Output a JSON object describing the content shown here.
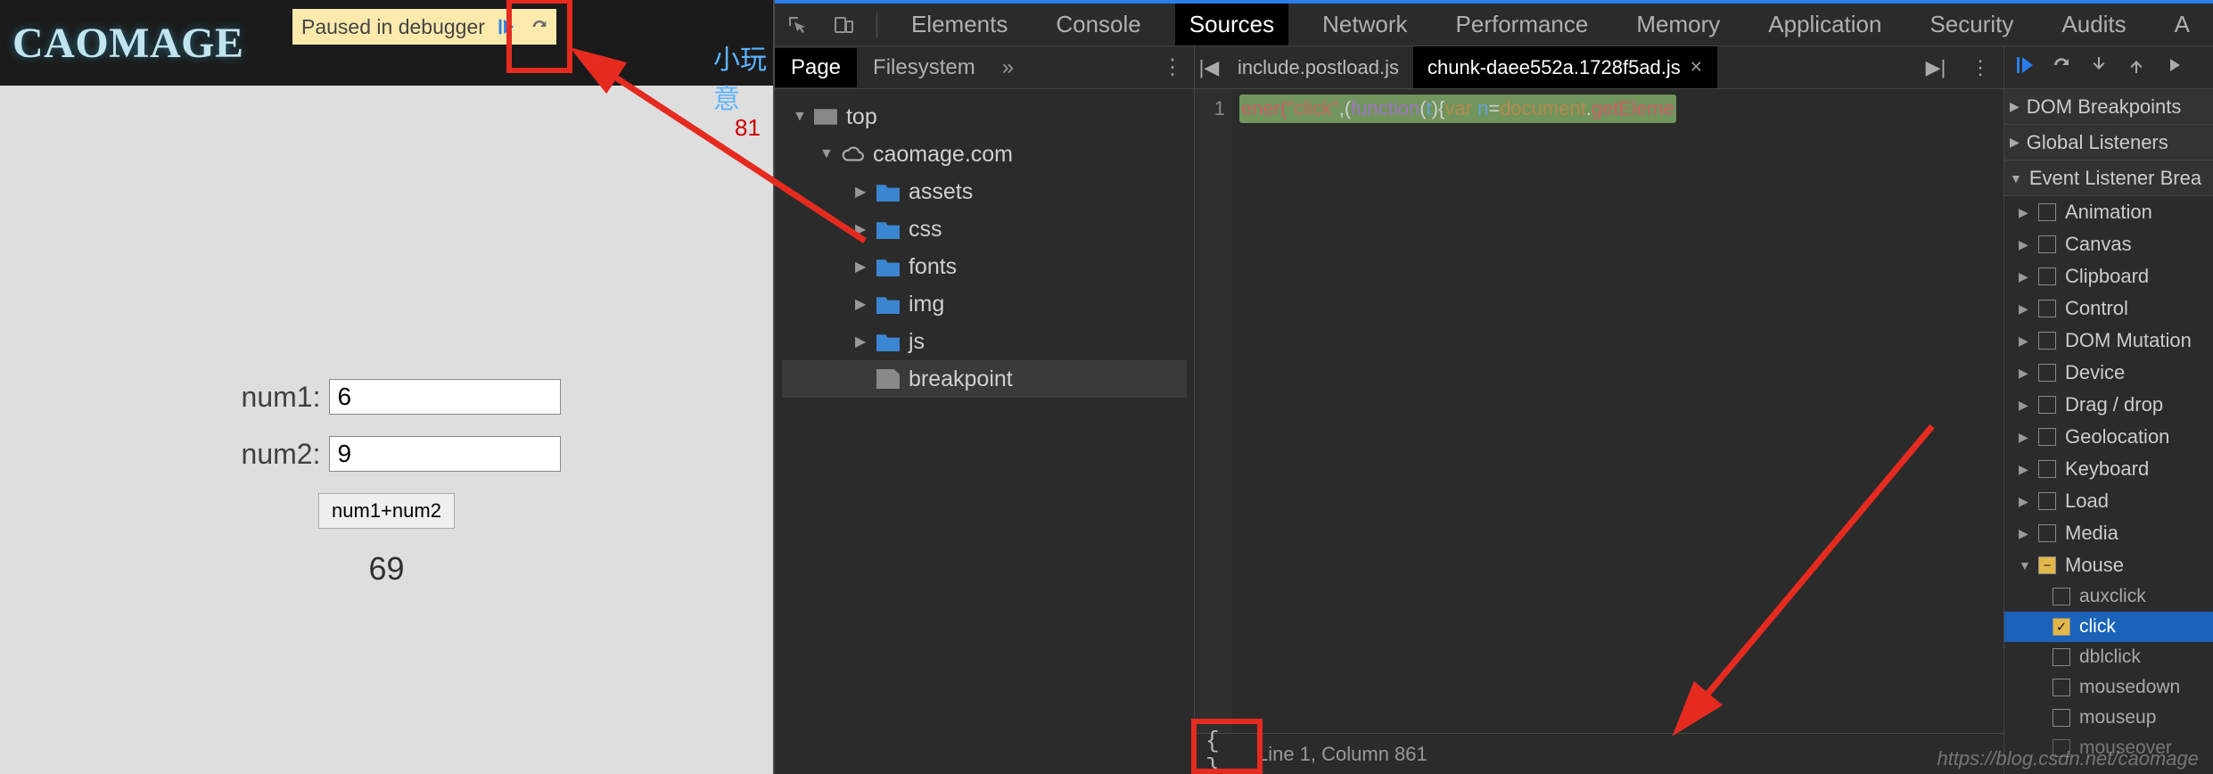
{
  "page": {
    "logo": "CAOMAGE",
    "paused_label": "Paused in debugger",
    "nav_item": "小玩意",
    "counter": "81",
    "form": {
      "num1_label": "num1:",
      "num2_label": "num2:",
      "num1_value": "6",
      "num2_value": "9",
      "sum_button": "num1+num2",
      "result": "69"
    }
  },
  "devtools": {
    "tabs": [
      "Elements",
      "Console",
      "Sources",
      "Network",
      "Performance",
      "Memory",
      "Application",
      "Security",
      "Audits",
      "A"
    ],
    "active_tab": "Sources",
    "files_panel": {
      "tabs": [
        "Page",
        "Filesystem"
      ],
      "active": "Page",
      "tree": {
        "top": "top",
        "domain": "caomage.com",
        "folders": [
          "assets",
          "css",
          "fonts",
          "img",
          "js"
        ],
        "file": "breakpoint"
      }
    },
    "editor": {
      "tabs": [
        {
          "label": "include.postload.js",
          "active": false
        },
        {
          "label": "chunk-daee552a.1728f5ad.js",
          "active": true
        }
      ],
      "line_no": "1",
      "code_tokens": {
        "t1": "ener(",
        "t2": "\"click\"",
        "t3": ",(",
        "t4": "function",
        "t5": "(",
        "t6": "t",
        "t7": "){",
        "t8": "var ",
        "t9": "n",
        "t10": "=",
        "t11": "document",
        "t12": ".",
        "t13": "getEleme"
      },
      "status": "Line 1, Column 861"
    },
    "sidebar": {
      "sections": [
        "DOM Breakpoints",
        "Global Listeners",
        "Event Listener Brea"
      ],
      "categories": [
        "Animation",
        "Canvas",
        "Clipboard",
        "Control",
        "DOM Mutation",
        "Device",
        "Drag / drop",
        "Geolocation",
        "Keyboard",
        "Load",
        "Media"
      ],
      "mouse_label": "Mouse",
      "mouse_events": [
        "auxclick",
        "click",
        "dblclick",
        "mousedown",
        "mouseup",
        "mouseover"
      ],
      "mouse_checked": "click"
    }
  },
  "watermark": "https://blog.csdn.net/caomage"
}
